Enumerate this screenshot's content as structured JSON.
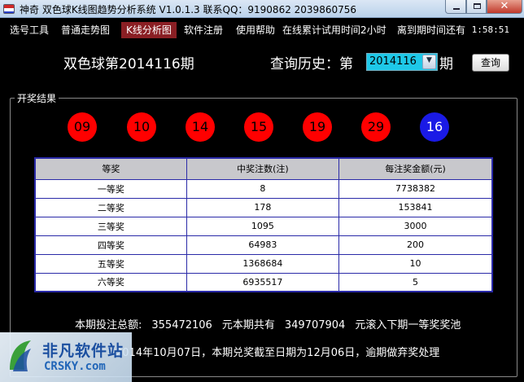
{
  "window": {
    "title": "神奇 双色球K线图趋势分析系统 V1.0.1.3  联系QQ：9190862  2039860756",
    "close_glyph": "✕",
    "max_glyph": "",
    "min_glyph": ""
  },
  "menu": {
    "items": [
      {
        "label": "选号工具"
      },
      {
        "label": "普通走势图"
      },
      {
        "label": "K线分析图",
        "active": true
      },
      {
        "label": "软件注册"
      },
      {
        "label": "使用帮助"
      },
      {
        "label": "在线累计试用时间2小时"
      },
      {
        "label": "离到期时间还有"
      }
    ],
    "timer": "1:58:51"
  },
  "header": {
    "issue_title": "双色球第2014116期",
    "query_label": "查询历史：第",
    "selected_issue": "2014116",
    "issue_suffix": "期",
    "query_button": "查询"
  },
  "result": {
    "legend": "开奖结果",
    "red_balls": [
      "09",
      "10",
      "14",
      "15",
      "19",
      "29"
    ],
    "blue_ball": "16",
    "colors": {
      "red_ball": "#ff0000",
      "blue_ball": "#1a1ae6"
    }
  },
  "table": {
    "headers": [
      "等奖",
      "中奖注数(注)",
      "每注奖金额(元)"
    ],
    "rows": [
      [
        "一等奖",
        "8",
        "7738382"
      ],
      [
        "二等奖",
        "178",
        "153841"
      ],
      [
        "三等奖",
        "1095",
        "3000"
      ],
      [
        "四等奖",
        "64983",
        "200"
      ],
      [
        "五等奖",
        "1368684",
        "10"
      ],
      [
        "六等奖",
        "6935517",
        "5"
      ]
    ]
  },
  "summary": {
    "total_label": "本期投注总额:",
    "total_value": "355472106",
    "pool_label": "元本期共有",
    "pool_value": "349707904",
    "pool_suffix": "元滚入下期一等奖奖池",
    "draw_info": "2014年10月07日，本期兑奖截至日期为12月06日，逾期做弃奖处理"
  },
  "watermark": {
    "cn": "非凡软件站",
    "en": "CRSKY.com"
  }
}
